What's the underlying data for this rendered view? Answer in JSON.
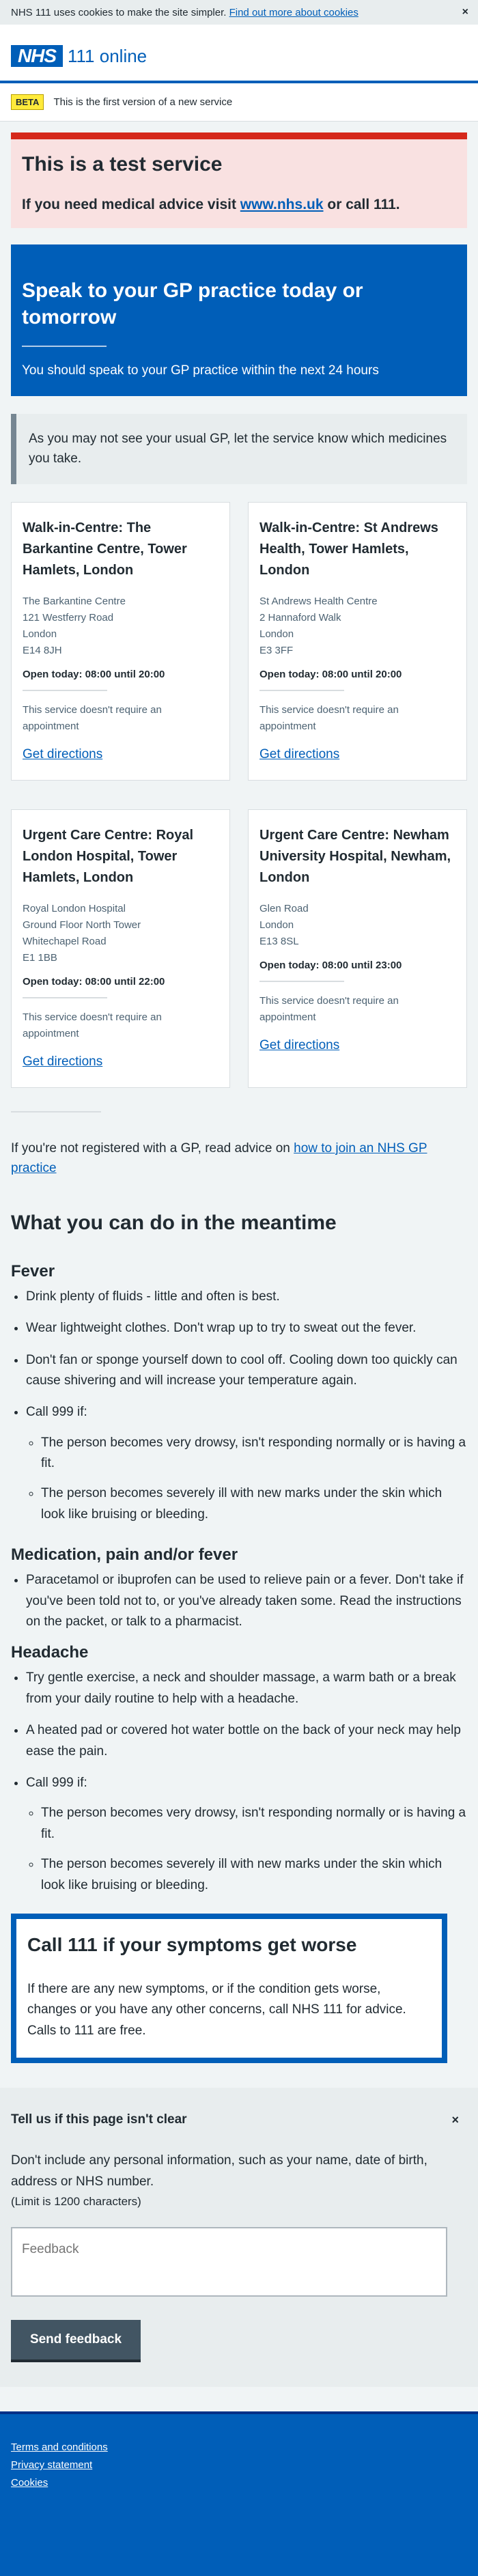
{
  "cookie_banner": {
    "text": "NHS 111 uses cookies to make the site simpler.",
    "link": "Find out more about cookies",
    "close": "×"
  },
  "header": {
    "logo": "NHS",
    "service_name": "111 online"
  },
  "beta": {
    "tag": "BETA",
    "text": "This is the first version of a new service"
  },
  "test_service": {
    "title": "This is a test service",
    "text_before": "If you need medical advice visit ",
    "link": "www.nhs.uk",
    "text_after": " or call 111."
  },
  "care_card": {
    "title": "Speak to your GP practice today or tomorrow",
    "text": "You should speak to your GP practice within the next 24 hours"
  },
  "inset": "As you may not see your usual GP, let the service know which medicines you take.",
  "services": [
    {
      "name": "Walk-in-Centre: The Barkantine Centre, Tower Hamlets, London",
      "address": [
        "The Barkantine Centre",
        "121 Westferry Road",
        "London",
        "E14 8JH"
      ],
      "opening": "Open today: 08:00 until 20:00",
      "appointment": "This service doesn't require an appointment",
      "directions": "Get directions"
    },
    {
      "name": "Walk-in-Centre: St Andrews Health, Tower Hamlets, London",
      "address": [
        "St Andrews Health Centre",
        "2 Hannaford Walk",
        "London",
        "E3 3FF"
      ],
      "opening": "Open today: 08:00 until 20:00",
      "appointment": "This service doesn't require an appointment",
      "directions": "Get directions"
    },
    {
      "name": "Urgent Care Centre: Royal London Hospital, Tower Hamlets, London",
      "address": [
        "Royal London Hospital",
        "Ground Floor North Tower",
        "Whitechapel Road",
        "E1 1BB"
      ],
      "opening": "Open today: 08:00 until 22:00",
      "appointment": "This service doesn't require an appointment",
      "directions": "Get directions"
    },
    {
      "name": "Urgent Care Centre: Newham University Hospital, Newham, London",
      "address": [
        "Glen Road",
        "London",
        "E13 8SL"
      ],
      "opening": "Open today: 08:00 until 23:00",
      "appointment": "This service doesn't require an appointment",
      "directions": "Get directions"
    }
  ],
  "gp_advice": {
    "text": "If you're not registered with a GP, read advice on ",
    "link": "how to join an NHS GP practice"
  },
  "meantime": {
    "title": "What you can do in the meantime",
    "fever": {
      "title": "Fever",
      "items": [
        "Drink plenty of fluids - little and often is best.",
        "Wear lightweight clothes. Don't wrap up to try to sweat out the fever.",
        "Don't fan or sponge yourself down to cool off. Cooling down too quickly can cause shivering and will increase your temperature again."
      ],
      "call_999": "Call 999 if:",
      "sub_items": [
        "The person becomes very drowsy, isn't responding normally or is having a fit.",
        "The person becomes severely ill with new marks under the skin which look like bruising or bleeding."
      ]
    },
    "medication": {
      "title": "Medication, pain and/or fever",
      "text": "Paracetamol or ibuprofen can be used to relieve pain or a fever. Don't take if you've been told not to, or you've already taken some. Read the instructions on the packet, or talk to a pharmacist."
    },
    "headache": {
      "title": "Headache",
      "items": [
        "Try gentle exercise, a neck and shoulder massage, a warm bath or a break from your daily routine to help with a headache.",
        "A heated pad or covered hot water bottle on the back of your neck may help ease the pain."
      ],
      "call_999": "Call 999 if:",
      "sub_items": [
        "The person becomes very drowsy, isn't responding normally or is having a fit.",
        "The person becomes severely ill with new marks under the skin which look like bruising or bleeding."
      ]
    }
  },
  "call_111": {
    "title": "Call 111 if your symptoms get worse",
    "text": "If there are any new symptoms, or if the condition gets worse, changes or you have any other concerns, call NHS 111 for advice. Calls to 111 are free."
  },
  "feedback": {
    "title": "Tell us if this page isn't clear",
    "close": "×",
    "text": "Don't include any personal information, such as your name, date of birth, address or NHS number.",
    "limit": "(Limit is 1200 characters)",
    "placeholder": "Feedback",
    "button": "Send feedback"
  },
  "footer": {
    "links": [
      "Terms and conditions",
      "Privacy statement",
      "Cookies"
    ]
  },
  "colors": {
    "nhs_blue": "#005eb8",
    "warning_red": "#d5281b",
    "beta_yellow": "#ffeb3b",
    "background": "#f0f4f5"
  }
}
